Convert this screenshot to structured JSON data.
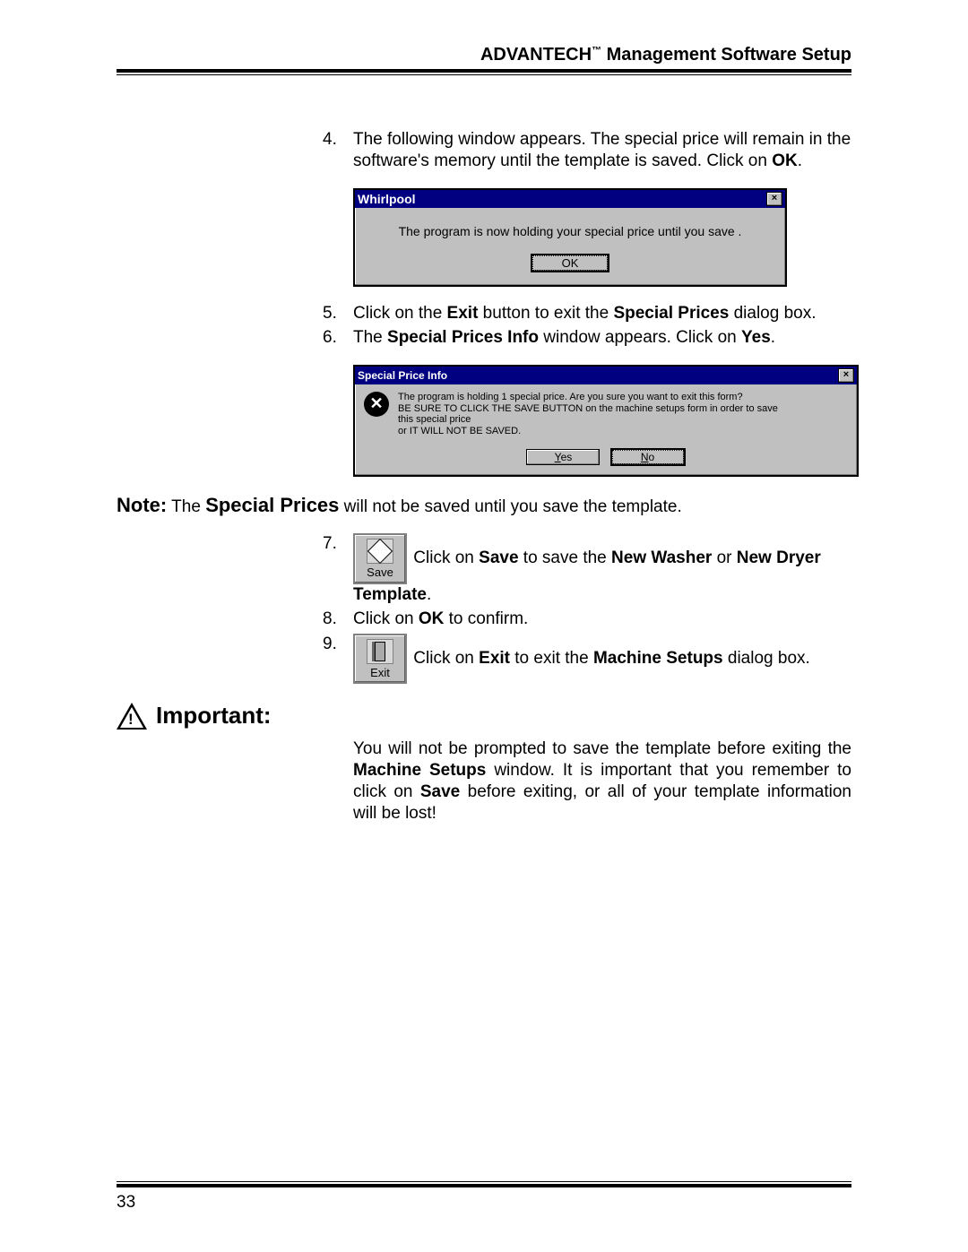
{
  "header": {
    "brand": "ADVANTECH",
    "tm": "™",
    "tail": " Management Software Setup"
  },
  "steps": {
    "s4": {
      "num": "4.",
      "text_a": "The following window appears. The special price will remain in the software's memory until the template is saved. Click on ",
      "bold_ok": "OK",
      "text_b": "."
    },
    "s5": {
      "num": "5.",
      "a": "Click on the ",
      "b_exit": "Exit",
      "c": " button to exit the ",
      "b_sp": "Special Prices",
      "d": " dialog box."
    },
    "s6": {
      "num": "6.",
      "a": "The ",
      "b_spi": "Special Prices Info",
      "c": " window appears. Click on ",
      "b_yes": "Yes",
      "d": "."
    },
    "s7": {
      "num": "7.",
      "a": " Click on ",
      "b_save": "Save",
      "c": " to save the ",
      "b_nw": "New Washer",
      "d": " or ",
      "b_nd": "New Dryer Template",
      "e": "."
    },
    "s8": {
      "num": "8.",
      "a": "Click on ",
      "b_ok": "OK",
      "c": " to confirm."
    },
    "s9": {
      "num": "9.",
      "a": " Click on ",
      "b_exit": "Exit",
      "c": " to exit the ",
      "b_ms": "Machine Setups",
      "d": " dialog box."
    }
  },
  "dialog1": {
    "title": "Whirlpool",
    "message": "The program is now holding your special price until you save .",
    "ok": "OK"
  },
  "dialog2": {
    "title": "Special Price Info",
    "line1": "The program is holding 1 special price.  Are you sure you want to exit this form?",
    "line2": "BE SURE TO CLICK THE SAVE BUTTON on the machine setups form in order to save",
    "line3": "this special price",
    "line4": "or IT WILL NOT BE SAVED.",
    "yes_u": "Y",
    "yes_r": "es",
    "no_u": "N",
    "no_r": "o"
  },
  "note": {
    "label": "Note:",
    "a": " The ",
    "b_sp": "Special Prices",
    "c": " will not be saved until you save the template."
  },
  "toolbar": {
    "save": "Save",
    "exit": "Exit"
  },
  "important": {
    "label": "Important:",
    "a": "You will not be prompted to save the template before exiting the ",
    "b_ms": "Machine Setups",
    "c": " window. It is important that you remember to click on ",
    "b_save": "Save",
    "d": " before exiting, or all of your template information will be lost!"
  },
  "page_number": "33"
}
